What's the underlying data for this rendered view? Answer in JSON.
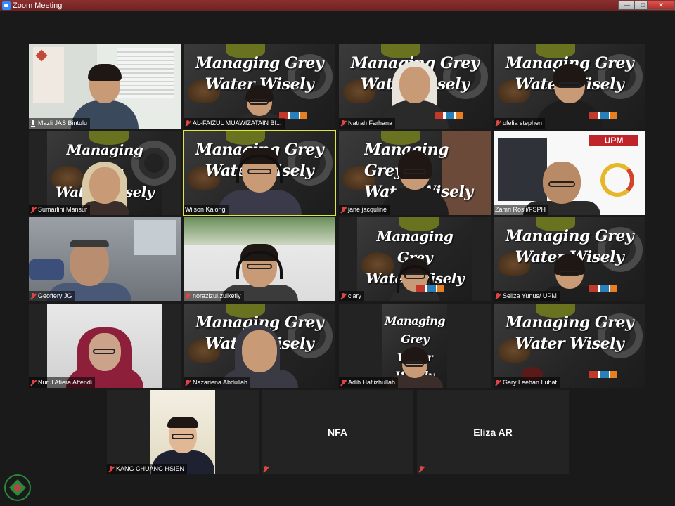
{
  "window": {
    "title": "Zoom Meeting",
    "controls": {
      "minimize": "—",
      "maximize": "□",
      "close": "✕"
    }
  },
  "poster": {
    "headline_line1": "Managing Grey",
    "headline_line2": "Water Wisely"
  },
  "participants": [
    {
      "name": "Mazli JAS Bintulu",
      "mic": "host"
    },
    {
      "name": "AL-FAIZUL MUAWIZATAIN BI...",
      "mic": "muted"
    },
    {
      "name": "Natrah Farhana",
      "mic": "muted"
    },
    {
      "name": "ofelia stephen",
      "mic": "muted"
    },
    {
      "name": "Sumarlini Mansur",
      "mic": "muted"
    },
    {
      "name": "Wilson Kalong",
      "mic": "on",
      "active_speaker": true
    },
    {
      "name": "jane jacquline",
      "mic": "muted"
    },
    {
      "name": "Zamri Rosli/FSPH",
      "mic": "none"
    },
    {
      "name": "Geoffery JG",
      "mic": "muted"
    },
    {
      "name": "norazizul.zulkefly",
      "mic": "muted"
    },
    {
      "name": "clary",
      "mic": "muted"
    },
    {
      "name": "Seliza Yunus/ UPM",
      "mic": "muted"
    },
    {
      "name": "Nurul Afiera Affendi",
      "mic": "muted"
    },
    {
      "name": "Nazariena Abdullah",
      "mic": "muted"
    },
    {
      "name": "Adib Hafiizhullah",
      "mic": "muted"
    },
    {
      "name": "Gary Leehan Luhat",
      "mic": "muted"
    },
    {
      "name": "KANG CHUANG HSIEN",
      "mic": "muted"
    },
    {
      "name": "",
      "mic": "muted",
      "display_text": "NFA"
    },
    {
      "name": "",
      "mic": "muted",
      "display_text": "Eliza AR"
    }
  ],
  "upm_tile": {
    "brand": "UPM"
  },
  "colors": {
    "titlebar": "#8c2f2f",
    "active_outline": "#e3e640",
    "muted_mic": "#e04545",
    "stage_bg": "#1a1a1a"
  }
}
